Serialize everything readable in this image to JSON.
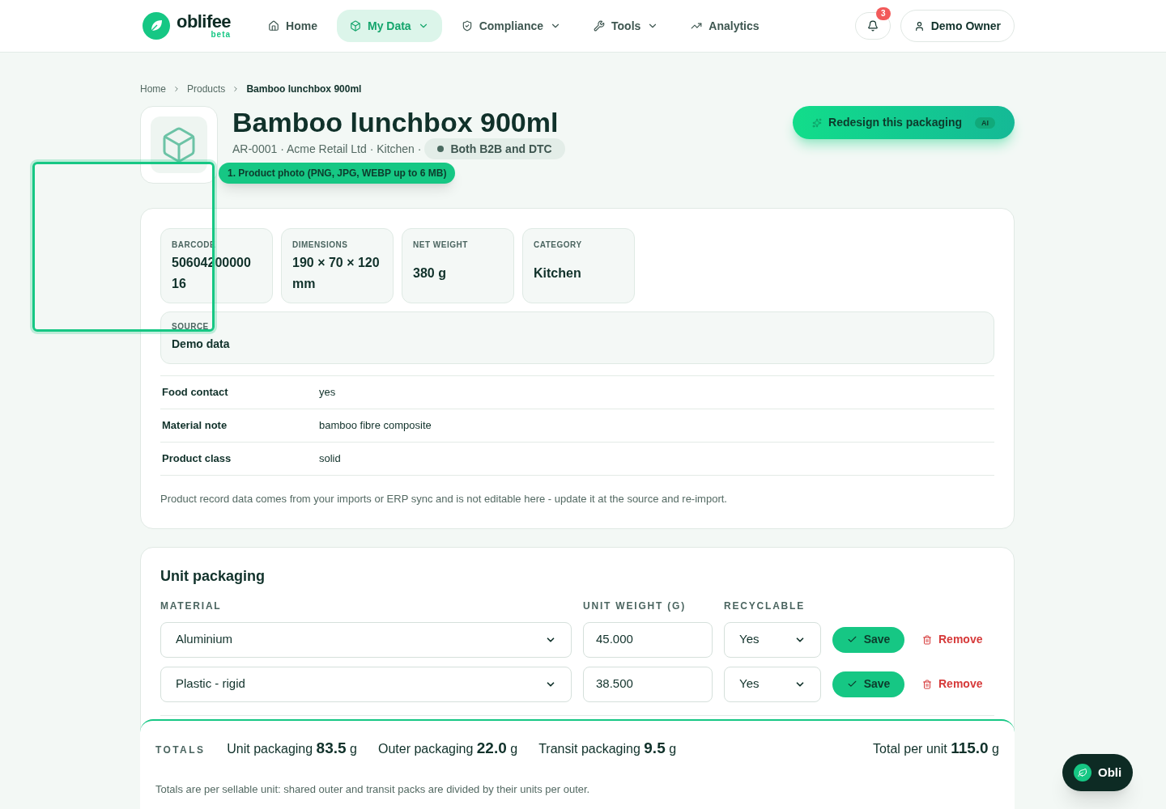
{
  "brand": {
    "name": "oblifee",
    "tag": "beta"
  },
  "nav": [
    {
      "label": "Home",
      "dropdown": false,
      "selected": false
    },
    {
      "label": "My Data",
      "dropdown": true,
      "selected": true
    },
    {
      "label": "Compliance",
      "dropdown": true,
      "selected": false
    },
    {
      "label": "Tools",
      "dropdown": true,
      "selected": false
    },
    {
      "label": "Analytics",
      "dropdown": false,
      "selected": false
    }
  ],
  "notifications": {
    "count": "3"
  },
  "user": {
    "name": "Demo Owner"
  },
  "breadcrumb": [
    "Home",
    "Products",
    "Bamboo lunchbox 900ml"
  ],
  "product": {
    "title": "Bamboo lunchbox 900ml",
    "meta": "AR-0001 · Acme Retail Ltd · Kitchen ·",
    "channel": "Both B2B and DTC"
  },
  "redesign_button": {
    "label": "Redesign this packaging",
    "badge": "AI"
  },
  "tour": {
    "tip": "1. Product photo (PNG, JPG, WEBP up to 6 MB)"
  },
  "stats": [
    {
      "label": "BARCODE",
      "value": "50604200000 16"
    },
    {
      "label": "DIMENSIONS",
      "value": "190 × 70 × 120 mm"
    },
    {
      "label": "NET WEIGHT",
      "value": "380 g"
    },
    {
      "label": "CATEGORY",
      "value": "Kitchen"
    }
  ],
  "source": {
    "label": "SOURCE",
    "value": "Demo data"
  },
  "attributes": [
    {
      "name": "Food contact",
      "value": "yes"
    },
    {
      "name": "Material note",
      "value": "bamboo fibre composite"
    },
    {
      "name": "Product class",
      "value": "solid"
    }
  ],
  "record_note": "Product record data comes from your imports or ERP sync and is not editable here - update it at the source and re-import.",
  "unit_packaging": {
    "title": "Unit packaging",
    "columns": [
      "MATERIAL",
      "UNIT WEIGHT (G)",
      "RECYCLABLE"
    ],
    "rows": [
      {
        "material": "Aluminium",
        "weight": "45.000",
        "recyclable": "Yes",
        "save": "Save",
        "remove": "Remove"
      },
      {
        "material": "Plastic - rigid",
        "weight": "38.500",
        "recyclable": "Yes",
        "save": "Save",
        "remove": "Remove"
      }
    ]
  },
  "totals": {
    "label": "TOTALS",
    "items": [
      {
        "name": "Unit packaging",
        "value": "83.5",
        "unit": "g"
      },
      {
        "name": "Outer packaging",
        "value": "22.0",
        "unit": "g"
      },
      {
        "name": "Transit packaging",
        "value": "9.5",
        "unit": "g"
      }
    ],
    "total": {
      "name": "Total per unit",
      "value": "115.0",
      "unit": "g"
    },
    "note": "Totals are per sellable unit: shared outer and transit packs are divided by their units per outer."
  },
  "assistant": {
    "label": "Obli"
  }
}
